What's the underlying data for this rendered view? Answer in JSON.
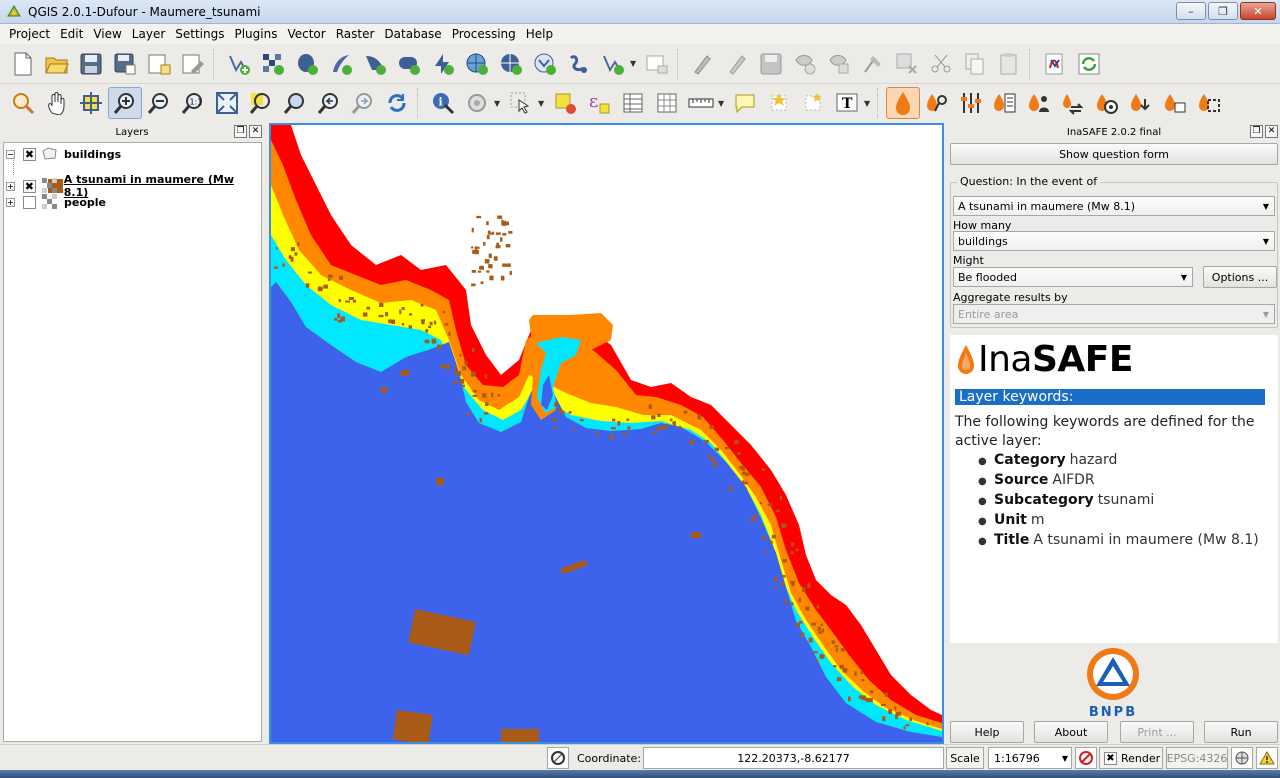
{
  "window": {
    "title": "QGIS 2.0.1-Dufour - Maumere_tsunami",
    "min": "–",
    "restore": "❐",
    "close": "✕"
  },
  "menu": [
    "Project",
    "Edit",
    "View",
    "Layer",
    "Settings",
    "Plugins",
    "Vector",
    "Raster",
    "Database",
    "Processing",
    "Help"
  ],
  "toolbar1_icons": [
    "new-project-icon",
    "open-project-icon",
    "save-project-icon",
    "save-as-icon",
    "new-print-composer-icon",
    "composer-manager-icon",
    "add-vector-layer-icon",
    "add-raster-layer-icon",
    "add-postgis-layer-icon",
    "add-spatialite-layer-icon",
    "add-mssql-layer-icon",
    "add-oracle-layer-icon",
    "add-wms-layer-icon",
    "add-wcs-layer-icon",
    "add-wfs-layer-icon",
    "add-delimited-text-icon",
    "new-shapefile-icon",
    "remove-layer-icon",
    "toggle-editing-icon",
    "edit-pencil-icon",
    "save-edits-icon",
    "add-feature-icon",
    "move-feature-icon",
    "node-tool-icon",
    "delete-selected-icon",
    "cut-features-icon",
    "copy-features-icon",
    "paste-features-icon",
    "python-console-icon",
    "refresh-plugin-icon"
  ],
  "toolbar2_icons": [
    "touch-zoom-icon",
    "pan-map-icon",
    "pan-to-selection-icon",
    "zoom-in-icon",
    "zoom-out-icon",
    "zoom-actual-size-icon",
    "zoom-full-icon",
    "zoom-to-selection-icon",
    "zoom-to-layer-icon",
    "zoom-last-icon",
    "zoom-next-icon",
    "refresh-icon",
    "identify-icon",
    "run-action-icon",
    "select-features-icon",
    "deselect-icon",
    "expression-select-icon",
    "attribute-table-icon",
    "field-calculator-icon",
    "measure-line-icon",
    "map-tips-icon",
    "new-bookmark-icon",
    "show-bookmarks-icon",
    "text-annotation-icon",
    "inasafe-dock-icon",
    "inasafe-keywords-icon",
    "inasafe-options-icon",
    "inasafe-impact-functions-icon",
    "inasafe-people-icon",
    "inasafe-converter-icon",
    "inasafe-batch-icon",
    "inasafe-save-scenario-icon",
    "inasafe-osm-icon",
    "inasafe-extent-icon"
  ],
  "layers_panel": {
    "title": "Layers",
    "layers": [
      {
        "name": "buildings",
        "checked": "✖",
        "expander": "−"
      },
      {
        "name": "A tsunami in maumere (Mw 8.1)",
        "checked": "✖",
        "expander": "+"
      },
      {
        "name": "people",
        "checked": "",
        "expander": "+"
      }
    ]
  },
  "inasafe": {
    "title": "InaSAFE 2.0.2 final",
    "show_question_form": "Show question form",
    "question_title": "Question: In the event of",
    "hazard": "A tsunami in maumere (Mw 8.1)",
    "how_many_label": "How many",
    "exposure": "buildings",
    "might_label": "Might",
    "impact_function": "Be flooded",
    "options_button": "Options ...",
    "aggregate_label": "Aggregate results by",
    "aggregate": "Entire area",
    "logo_light": "Ina",
    "logo_bold": "SAFE",
    "keywords_heading": "Layer keywords:",
    "keywords_intro": "The following keywords are defined for the active layer:",
    "keywords": [
      {
        "key": "Category",
        "value": "hazard"
      },
      {
        "key": "Source",
        "value": "AIFDR"
      },
      {
        "key": "Subcategory",
        "value": "tsunami"
      },
      {
        "key": "Unit",
        "value": "m"
      },
      {
        "key": "Title",
        "value": "A tsunami in maumere (Mw 8.1)"
      }
    ],
    "bnpb_text": "BNPB",
    "buttons": {
      "help": "Help",
      "about": "About",
      "print": "Print ...",
      "run": "Run"
    }
  },
  "statusbar": {
    "coordinate_label": "Coordinate:",
    "coordinate_value": "122.20373,-8.62177",
    "scale_label": "Scale",
    "scale_value": "1:16796",
    "render_label": "Render",
    "render_checked": "✖",
    "crs": "EPSG:4326"
  },
  "colors": {
    "water": "#3d63ed",
    "buildings": "#a95a16",
    "depth_high": "#ff0000",
    "depth_mid": "#ff8800",
    "depth_low": "#ffff00",
    "depth_shallow": "#00e8ff",
    "inasafe_orange": "#f07a13",
    "keyword_heading": "#1a6ec8"
  }
}
